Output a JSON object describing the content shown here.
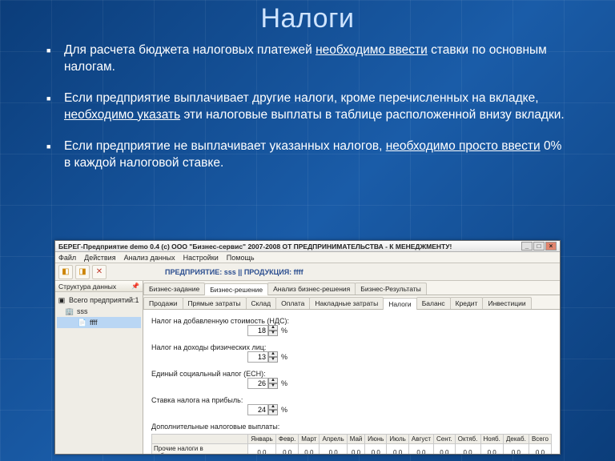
{
  "slide": {
    "title": "Налоги",
    "b1a": "Для расчета бюджета налоговых платежей ",
    "b1u": "необходимо ввести",
    "b1b": " ставки по основным налогам.",
    "b2a": "Если предприятие выплачивает другие налоги, кроме перечисленных на вкладке, ",
    "b2u": "необходимо указать",
    "b2b": " эти налоговые выплаты в таблице расположенной внизу вкладки.",
    "b3a": "Если предприятие не выплачивает указанных налогов, ",
    "b3u": "необходимо просто ввести",
    "b3b": " 0% в каждой налоговой ставке."
  },
  "app": {
    "title": "БЕРЕГ-Предприятие demo 0.4   (c) ООО \"Бизнес-сервис\" 2007-2008  ОТ ПРЕДПРИНИМАТЕЛЬСТВА - К МЕНЕДЖМЕНТУ!",
    "menu": [
      "Файл",
      "Действия",
      "Анализ данных",
      "Настройки",
      "Помощь"
    ],
    "enterprise": "ПРЕДПРИЯТИЕ: sss  ||  ПРОДУКЦИЯ: ffff",
    "sidebar": {
      "header": "Структура данных",
      "root": "Всего предприятий:1",
      "node1": "sss",
      "node2": "ffff"
    },
    "tabs1": [
      "Бизнес-задание",
      "Бизнес-решение",
      "Анализ бизнес-решения",
      "Бизнес-Результаты"
    ],
    "tabs2": [
      "Продажи",
      "Прямые затраты",
      "Склад",
      "Оплата",
      "Накладные затраты",
      "Налоги",
      "Баланс",
      "Кредит",
      "Инвестиции"
    ],
    "tabs1_active": 1,
    "tabs2_active": 5,
    "taxes": [
      {
        "label": "Налог на добавленную стоимость (НДС):",
        "value": "18"
      },
      {
        "label": "Налог на доходы физических лиц:",
        "value": "13"
      },
      {
        "label": "Единый социальный налог (ЕСН):",
        "value": "26"
      },
      {
        "label": "Ставка налога на прибыль:",
        "value": "24"
      }
    ],
    "extra_label": "Дополнительные налоговые выплаты:",
    "months": [
      "Январь",
      "Февр.",
      "Март",
      "Апрель",
      "Май",
      "Июнь",
      "Июль",
      "Август",
      "Сент.",
      "Октяб.",
      "Нояб.",
      "Декаб.",
      "Всего"
    ],
    "gridrow": "Прочие налоги в себестоимост",
    "zero": "0,0"
  }
}
